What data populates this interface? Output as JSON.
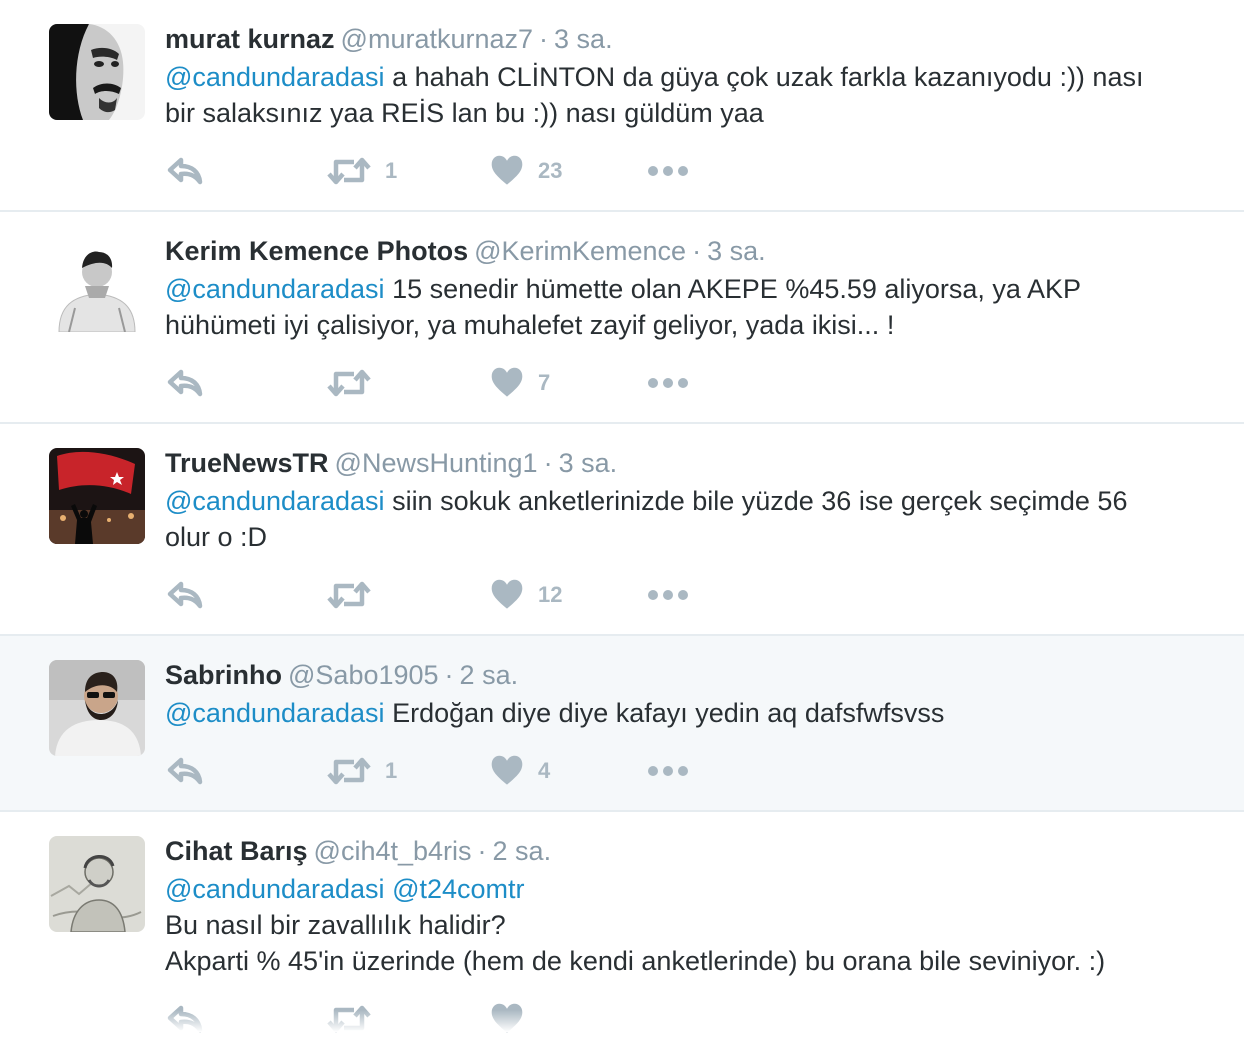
{
  "tweets": [
    {
      "name": "murat kurnaz",
      "handle": "@muratkurnaz7",
      "separator": "·",
      "time": "3 sa.",
      "mention1": "@candundaradasi",
      "mention2": "",
      "line1": " a hahah CLİNTON da güya çok uzak farkla kazanıyodu :)) nası",
      "line2": "bir salaksınız yaa REİS lan bu :)) nası güldüm yaa",
      "line3": "",
      "retweets": "1",
      "likes": "23"
    },
    {
      "name": "Kerim Kemence Photos",
      "handle": "@KerimKemence",
      "separator": "·",
      "time": "3 sa.",
      "mention1": "@candundaradasi",
      "mention2": "",
      "line1": " 15 senedir hümette olan AKEPE %45.59 aliyorsa, ya AKP",
      "line2": "hühümeti iyi çalisiyor, ya muhalefet zayif geliyor, yada ikisi... !",
      "line3": "",
      "retweets": "",
      "likes": "7"
    },
    {
      "name": "TrueNewsTR",
      "handle": "@NewsHunting1",
      "separator": "·",
      "time": "3 sa.",
      "mention1": "@candundaradasi",
      "mention2": "",
      "line1": " siin sokuk anketlerinizde bile yüzde 36 ise gerçek seçimde 56",
      "line2": "olur o :D",
      "line3": "",
      "retweets": "",
      "likes": "12"
    },
    {
      "name": "Sabrinho",
      "handle": "@Sabo1905",
      "separator": "·",
      "time": "2 sa.",
      "mention1": "@candundaradasi",
      "mention2": "",
      "line1": " Erdoğan diye diye kafayı yedin aq dafsfwfsvss",
      "line2": "",
      "line3": "",
      "retweets": "1",
      "likes": "4"
    },
    {
      "name": "Cihat Barış",
      "handle": "@cih4t_b4ris",
      "separator": "·",
      "time": "2 sa.",
      "mention1": "@candundaradasi",
      "mention2": "@t24comtr",
      "line1": "",
      "line2": "Bu nasıl bir zavallılık halidir?",
      "line3": "Akparti % 45'in üzerinde (hem de kendi anketlerinde) bu orana bile seviniyor. :)",
      "retweets": "",
      "likes": ""
    }
  ],
  "icons": {
    "reply": "reply-icon",
    "retweet": "retweet-icon",
    "like": "heart-icon",
    "more": "more-icon"
  },
  "colors": {
    "name": "#292f33",
    "meta": "#8899a6",
    "mention": "#1d8dc7",
    "action_icon": "#aab8c2",
    "divider": "#e6ecf0",
    "highlight_row": "#f5f8fa"
  }
}
